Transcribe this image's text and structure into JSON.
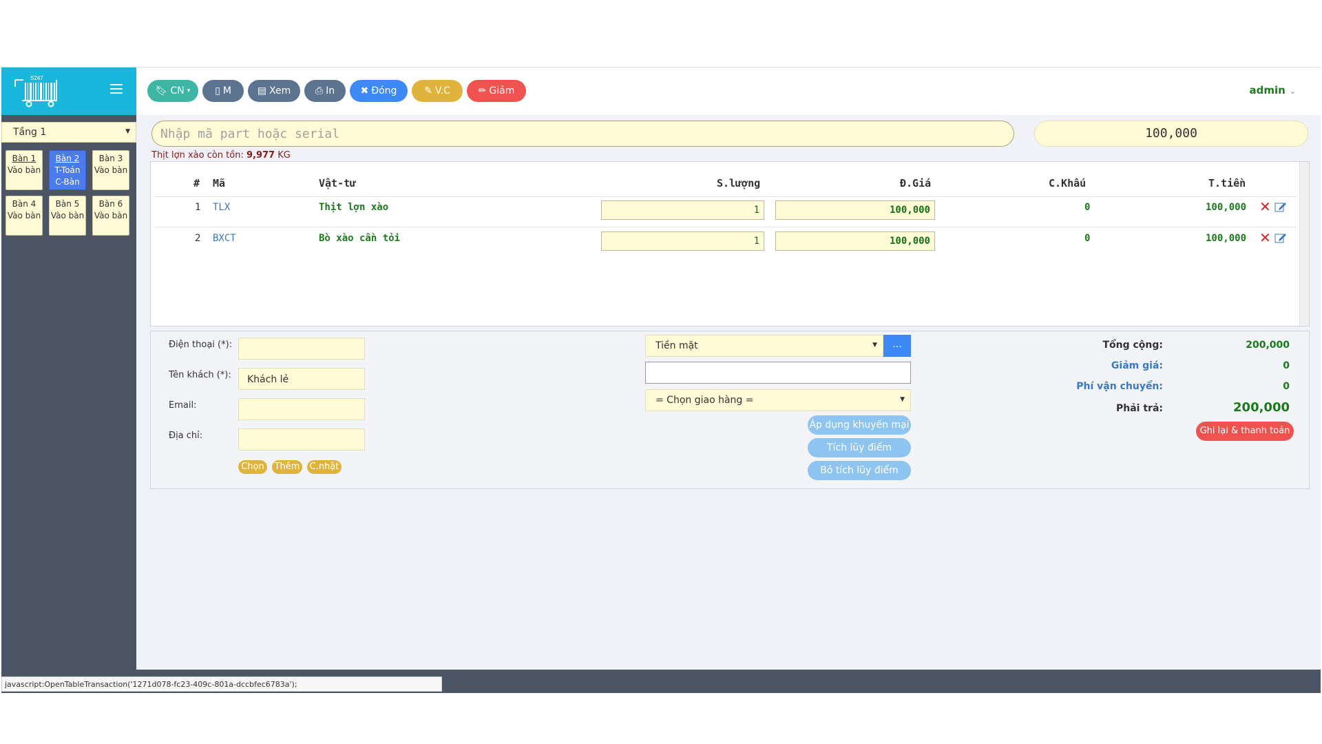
{
  "logo": {
    "text": "S247"
  },
  "sidebar": {
    "floor": "Tầng 1",
    "tables": [
      {
        "name": "Bàn 1",
        "status": "Vào bàn"
      },
      {
        "name": "Bàn 2",
        "status": "T-Toán C-Bàn"
      },
      {
        "name": "Bàn 3",
        "status": "Vào bàn"
      },
      {
        "name": "Bàn 4",
        "status": "Vào bàn"
      },
      {
        "name": "Bàn 5",
        "status": "Vào bàn"
      },
      {
        "name": "Bàn 6",
        "status": "Vào bàn"
      }
    ]
  },
  "toolbar": {
    "buttons": [
      {
        "label": "CN",
        "icon": "bookmark-icon",
        "color": "#3fb6a3"
      },
      {
        "label": "M",
        "icon": "file-icon",
        "color": "#5d7490"
      },
      {
        "label": "Xem",
        "icon": "file-text-icon",
        "color": "#5d7490"
      },
      {
        "label": "In",
        "icon": "print-icon",
        "color": "#5d7490"
      },
      {
        "label": "Đóng",
        "icon": "close-icon",
        "color": "#3d8af7"
      },
      {
        "label": "V.C",
        "icon": "edit-icon",
        "color": "#e0b43c"
      },
      {
        "label": "Giảm",
        "icon": "pencil-icon",
        "color": "#ef5350"
      }
    ],
    "user": "admin"
  },
  "search": {
    "placeholder": "Nhập mã part hoặc serial",
    "total": "100,000"
  },
  "stock_note": {
    "prefix": "Thịt lợn xào còn tồn: ",
    "qty": "9,977",
    "unit": " KG"
  },
  "items": {
    "headers": [
      "#",
      "Mã",
      "Vật-tư",
      "S.lượng",
      "Đ.Giá",
      "C.Khấu",
      "T.tiền"
    ],
    "rows": [
      {
        "no": "1",
        "code": "TLX",
        "name": "Thịt lợn xào",
        "qty": "1",
        "price": "100,000",
        "discount": "0",
        "total": "100,000"
      },
      {
        "no": "2",
        "code": "BXCT",
        "name": "Bò xào cần tỏi",
        "qty": "1",
        "price": "100,000",
        "discount": "0",
        "total": "100,000"
      }
    ]
  },
  "customer": {
    "phone_label": "Điện thoại (*):",
    "phone_value": "",
    "name_label": "Tên khách (*):",
    "name_value": "Khách lẻ",
    "email_label": "Email:",
    "email_value": "",
    "address_label": "Địa chỉ:",
    "address_value": "",
    "buttons": [
      "Chọn",
      "Thêm",
      "C.nhật"
    ]
  },
  "payment": {
    "method": "Tiền mặt",
    "more_label": "...",
    "note_value": "",
    "delivery": "= Chọn giao hàng =",
    "promo_label": "Áp dụng khuyến mại",
    "accumulate_label": "Tích lũy điểm",
    "remove_accumulate_label": "Bỏ tích lũy điểm"
  },
  "summary": {
    "total_label": "Tổng cộng:",
    "total": "200,000",
    "discount_label": "Giảm giá:",
    "discount": "0",
    "shipping_label": "Phí vận chuyển:",
    "shipping": "0",
    "pay_label": "Phải trả:",
    "pay": "200,000",
    "checkout_label": "Ghi lại & thanh toán"
  },
  "statusbar": {
    "url": "javascript:OpenTableTransaction('1271d078-fc23-409c-801a-dccbfec6783a');"
  },
  "colors": {
    "accent": "#1ab7dd",
    "sidebar": "#4b5563",
    "field": "#fffbd6",
    "green": "#1a7a1a",
    "red": "#d62020"
  }
}
